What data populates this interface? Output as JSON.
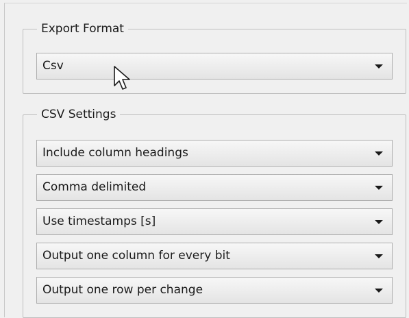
{
  "export_format": {
    "title": "Export Format",
    "selected": "Csv"
  },
  "csv_settings": {
    "title": "CSV Settings",
    "options": [
      "Include column headings",
      "Comma delimited",
      "Use timestamps [s]",
      "Output one column for every bit",
      "Output one row per change"
    ]
  },
  "icons": {
    "dropdown_arrow": "triangle-down",
    "cursor": "mouse-pointer"
  }
}
